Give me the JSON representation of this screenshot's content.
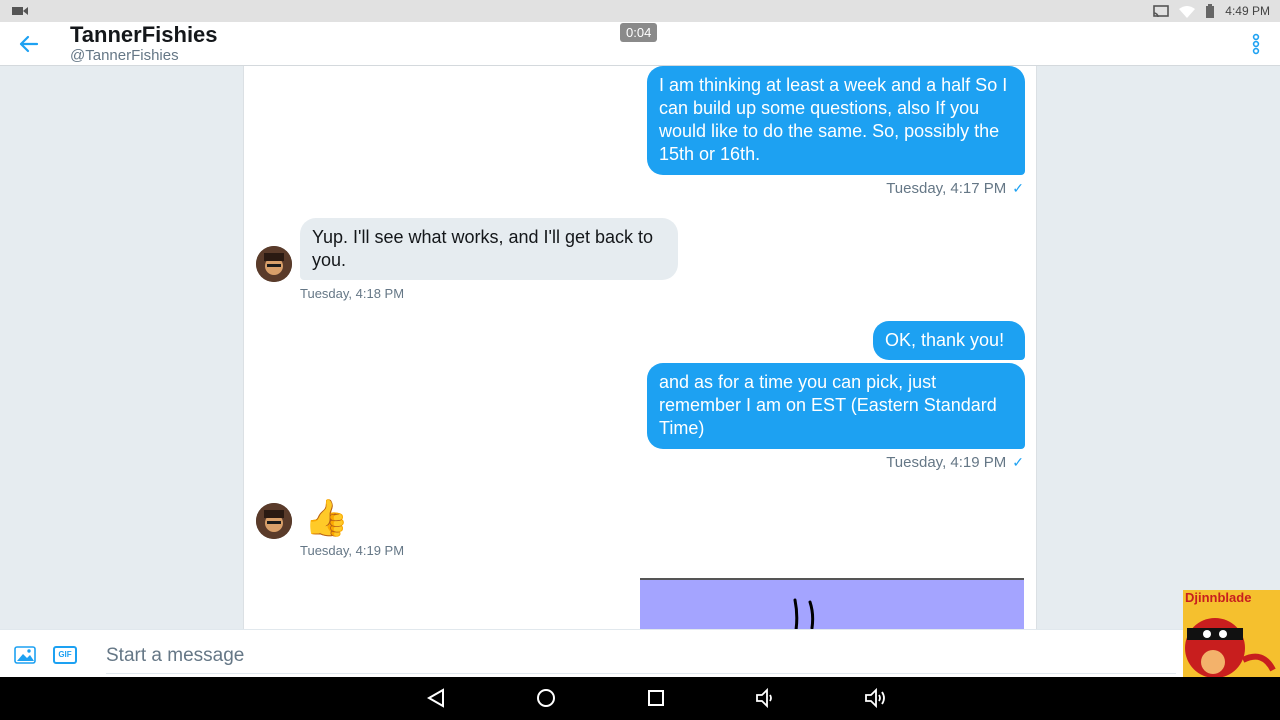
{
  "status_bar": {
    "time": "4:49 PM"
  },
  "header": {
    "title": "TannerFishies",
    "handle": "@TannerFishies",
    "timer": "0:04"
  },
  "messages": [
    {
      "direction": "out",
      "text": "I am thinking at least a week and a half So I can build up some questions, also If you would like to do the same. So, possibly the 15th or 16th.",
      "timestamp": "Tuesday, 4:17 PM"
    },
    {
      "direction": "in",
      "text": "Yup. I'll see what works, and I'll get back to you.",
      "timestamp": "Tuesday, 4:18 PM"
    },
    {
      "direction": "out",
      "text": "OK, thank you!"
    },
    {
      "direction": "out",
      "text": "and as for a time you can pick, just remember I am on EST (Eastern Standard Time)",
      "timestamp": "Tuesday, 4:19 PM"
    },
    {
      "direction": "in",
      "emoji": "👍",
      "timestamp": "Tuesday, 4:19 PM"
    }
  ],
  "composer": {
    "placeholder": "Start a message",
    "gif_label": "GIF"
  },
  "overlay": {
    "text": "Djinnblade"
  },
  "colors": {
    "accent": "#1da1f2",
    "incoming_bubble": "#e6ecf0"
  },
  "icons": [
    "back-arrow-icon",
    "more-vert-icon",
    "image-icon",
    "gif-icon",
    "nav-back-icon",
    "nav-home-icon",
    "nav-recents-icon",
    "volume-down-icon",
    "volume-up-icon"
  ]
}
